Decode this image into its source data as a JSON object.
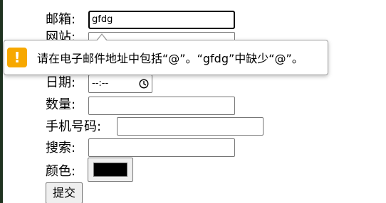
{
  "form": {
    "email": {
      "label": "邮箱:",
      "value": "gfdg"
    },
    "website": {
      "label": "网站:",
      "value": ""
    },
    "date": {
      "label": "日期:",
      "value": "--:--"
    },
    "quantity": {
      "label": "数量:",
      "value": ""
    },
    "phone": {
      "label": "手机号码:",
      "value": ""
    },
    "search": {
      "label": "搜索:",
      "value": ""
    },
    "color": {
      "label": "颜色:",
      "value": "#000000"
    },
    "submit": {
      "label": "提交"
    }
  },
  "validation_tooltip": {
    "icon": "warning-icon",
    "icon_glyph": "!",
    "icon_color": "#f7a800",
    "message": "请在电子邮件地址中包括“@”。“gfdg”中缺少“@”。"
  }
}
